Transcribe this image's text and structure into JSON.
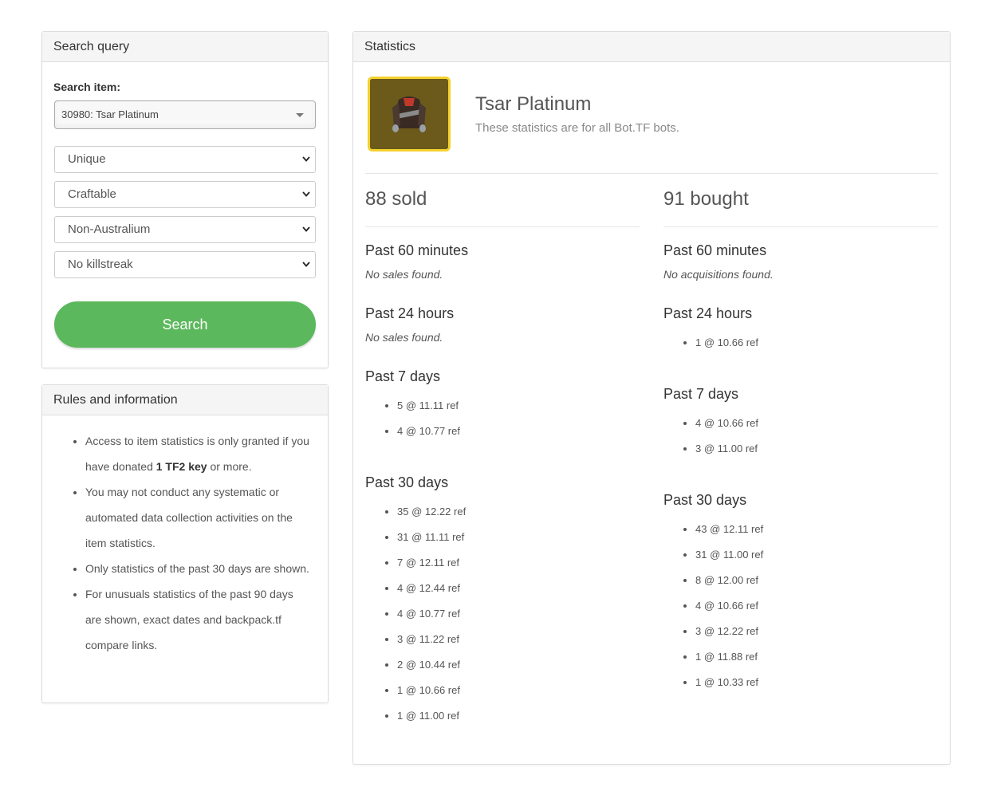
{
  "search_panel": {
    "title": "Search query",
    "item_label": "Search item:",
    "item_value": "30980: Tsar Platinum",
    "selects": [
      "Unique",
      "Craftable",
      "Non-Australium",
      "No killstreak"
    ],
    "search_button": "Search"
  },
  "rules_panel": {
    "title": "Rules and information",
    "rule1_pre": "Access to item statistics is only granted if you have donated ",
    "rule1_bold": "1 TF2 key",
    "rule1_post": " or more.",
    "rule2": "You may not conduct any systematic or automated data collection activities on the item statistics.",
    "rule3": "Only statistics of the past 30 days are shown.",
    "rule4": "For unusuals statistics of the past 90 days are shown, exact dates and backpack.tf compare links."
  },
  "stats_panel": {
    "title": "Statistics",
    "item_name": "Tsar Platinum",
    "item_subtitle": "These statistics are for all Bot.TF bots.",
    "sold": {
      "headline": "88 sold",
      "p60_title": "Past 60 minutes",
      "p60_empty": "No sales found.",
      "p24_title": "Past 24 hours",
      "p24_empty": "No sales found.",
      "p7_title": "Past 7 days",
      "p7": [
        "5 @ 11.11 ref",
        "4 @ 10.77 ref"
      ],
      "p30_title": "Past 30 days",
      "p30": [
        "35 @ 12.22 ref",
        "31 @ 11.11 ref",
        "7 @ 12.11 ref",
        "4 @ 12.44 ref",
        "4 @ 10.77 ref",
        "3 @ 11.22 ref",
        "2 @ 10.44 ref",
        "1 @ 10.66 ref",
        "1 @ 11.00 ref"
      ]
    },
    "bought": {
      "headline": "91 bought",
      "p60_title": "Past 60 minutes",
      "p60_empty": "No acquisitions found.",
      "p24_title": "Past 24 hours",
      "p24": [
        "1 @ 10.66 ref"
      ],
      "p7_title": "Past 7 days",
      "p7": [
        "4 @ 10.66 ref",
        "3 @ 11.00 ref"
      ],
      "p30_title": "Past 30 days",
      "p30": [
        "43 @ 12.11 ref",
        "31 @ 11.00 ref",
        "8 @ 12.00 ref",
        "4 @ 10.66 ref",
        "3 @ 12.22 ref",
        "1 @ 11.88 ref",
        "1 @ 10.33 ref"
      ]
    }
  },
  "colors": {
    "search_button": "#5cb85c",
    "item_border": "#f4d12e"
  },
  "icons": {
    "select2_caret": "caret-down-icon",
    "select_chevron": "chevron-down-icon",
    "item": "tsar-platinum-item-icon"
  }
}
